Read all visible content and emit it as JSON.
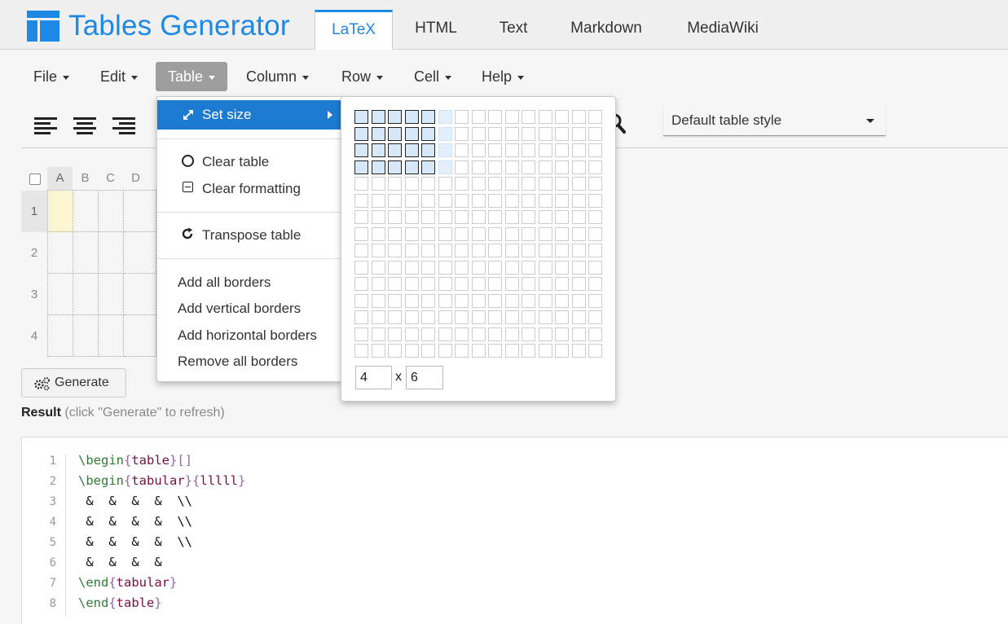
{
  "app": {
    "title": "Tables Generator"
  },
  "tabs": [
    {
      "label": "LaTeX",
      "active": true
    },
    {
      "label": "HTML"
    },
    {
      "label": "Text"
    },
    {
      "label": "Markdown"
    },
    {
      "label": "MediaWiki"
    }
  ],
  "menus": [
    {
      "label": "File"
    },
    {
      "label": "Edit"
    },
    {
      "label": "Table",
      "open": true
    },
    {
      "label": "Column"
    },
    {
      "label": "Row"
    },
    {
      "label": "Cell"
    },
    {
      "label": "Help"
    }
  ],
  "style_select": {
    "value": "Default table style"
  },
  "editor": {
    "columns": [
      "A",
      "B",
      "C",
      "D"
    ],
    "rows": [
      "1",
      "2",
      "3",
      "4"
    ]
  },
  "generate_label": "Generate",
  "result": {
    "label": "Result",
    "hint": "(click \"Generate\" to refresh)"
  },
  "code_lines": [
    {
      "n": "1",
      "parts": [
        {
          "t": "\\begin",
          "c": "kw"
        },
        {
          "t": "{",
          "c": "br"
        },
        {
          "t": "table",
          "c": "arg"
        },
        {
          "t": "}",
          "c": "br"
        },
        {
          "t": "[]",
          "c": "br"
        }
      ]
    },
    {
      "n": "2",
      "parts": [
        {
          "t": "\\begin",
          "c": "kw"
        },
        {
          "t": "{",
          "c": "br"
        },
        {
          "t": "tabular",
          "c": "arg"
        },
        {
          "t": "}",
          "c": "br"
        },
        {
          "t": "{",
          "c": "br"
        },
        {
          "t": "lllll",
          "c": "arg"
        },
        {
          "t": "}",
          "c": "br"
        }
      ]
    },
    {
      "n": "3",
      "parts": [
        {
          "t": " &  &  &  &  \\\\",
          "c": "pl"
        }
      ]
    },
    {
      "n": "4",
      "parts": [
        {
          "t": " &  &  &  &  \\\\",
          "c": "pl"
        }
      ]
    },
    {
      "n": "5",
      "parts": [
        {
          "t": " &  &  &  &  \\\\",
          "c": "pl"
        }
      ]
    },
    {
      "n": "6",
      "parts": [
        {
          "t": " &  &  &  &",
          "c": "pl"
        }
      ]
    },
    {
      "n": "7",
      "parts": [
        {
          "t": "\\end",
          "c": "kw"
        },
        {
          "t": "{",
          "c": "br"
        },
        {
          "t": "tabular",
          "c": "arg"
        },
        {
          "t": "}",
          "c": "br"
        }
      ]
    },
    {
      "n": "8",
      "parts": [
        {
          "t": "\\end",
          "c": "kw"
        },
        {
          "t": "{",
          "c": "br"
        },
        {
          "t": "table",
          "c": "arg"
        },
        {
          "t": "}",
          "c": "br"
        }
      ]
    }
  ],
  "table_menu": {
    "set_size": "Set size",
    "clear_table": "Clear table",
    "clear_formatting": "Clear formatting",
    "transpose_table": "Transpose table",
    "add_all_borders": "Add all borders",
    "add_vertical_borders": "Add vertical borders",
    "add_horizontal_borders": "Add horizontal borders",
    "remove_all_borders": "Remove all borders"
  },
  "size_picker": {
    "grid_rows": 15,
    "grid_cols": 15,
    "selected_rows": 4,
    "selected_cols": 5,
    "hover_rows": 4,
    "hover_cols": 6,
    "rows_value": "4",
    "x_label": "x",
    "cols_value": "6"
  },
  "colors": {
    "accent": "#1e88e5",
    "menu_highlight": "#1c7bd1",
    "selected_cell": "#fdf6d3"
  }
}
